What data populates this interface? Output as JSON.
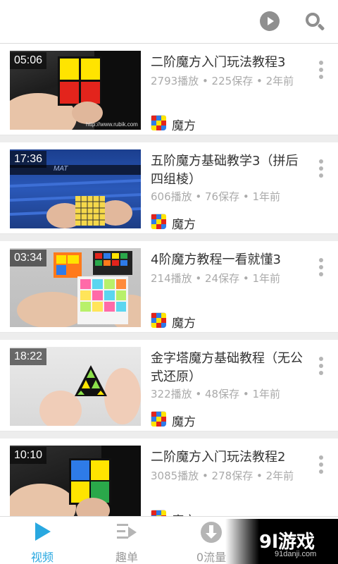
{
  "header": {
    "play_icon": "play-circle-icon",
    "search_icon": "search-icon"
  },
  "videos": [
    {
      "duration": "05:06",
      "title": "二阶魔方入门玩法教程3",
      "meta": "2793播放 • 225保存 • 2年前",
      "channel": "魔方",
      "thumb_watermark": "http://www.rubik.com"
    },
    {
      "duration": "17:36",
      "title": "五阶魔方基础教学3（拼后四组棱）",
      "meta": "606播放 • 76保存 • 1年前",
      "channel": "魔方",
      "thumb_watermark": "MAT"
    },
    {
      "duration": "03:34",
      "title": "4阶魔方教程一看就懂3",
      "meta": "214播放 • 24保存 • 1年前",
      "channel": "魔方",
      "thumb_watermark": ""
    },
    {
      "duration": "18:22",
      "title": "金字塔魔方基础教程（无公式还原）",
      "meta": "322播放 • 48保存 • 1年前",
      "channel": "魔方",
      "thumb_watermark": ""
    },
    {
      "duration": "10:10",
      "title": "二阶魔方入门玩法教程2",
      "meta": "3085播放 • 278保存 • 2年前",
      "channel": "魔方",
      "thumb_watermark": ""
    }
  ],
  "tabs": [
    {
      "label": "视频",
      "icon": "play-triangle-icon",
      "active": true
    },
    {
      "label": "趣单",
      "icon": "playlist-icon",
      "active": false
    },
    {
      "label": "0流量",
      "icon": "download-icon",
      "active": false
    }
  ],
  "watermark": {
    "main": "9l游戏",
    "sub": "91danji.com"
  },
  "colors": {
    "accent": "#29a8e0",
    "text_primary": "#333333",
    "text_secondary": "#aaaaaa"
  }
}
